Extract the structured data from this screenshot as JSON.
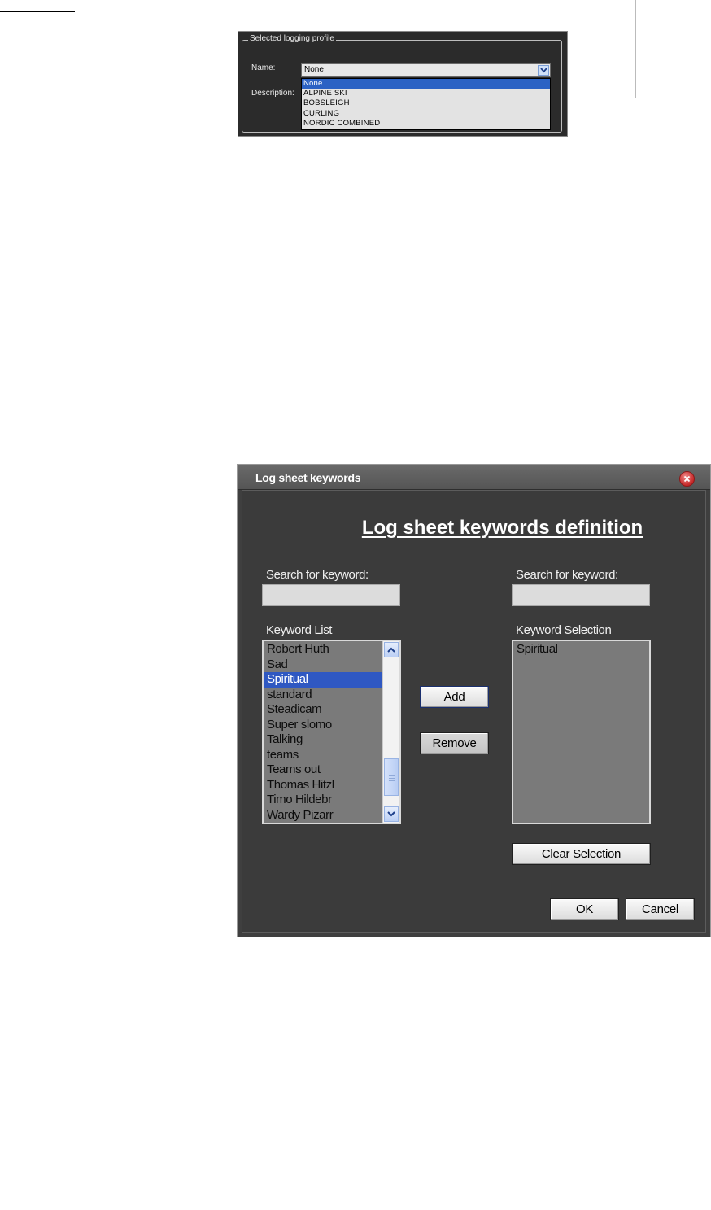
{
  "profile_panel": {
    "group_title": "Selected logging profile",
    "name_label": "Name:",
    "description_label": "Description:",
    "name_value": "None",
    "dropdown_options": [
      "None",
      "ALPINE SKI",
      "BOBSLEIGH",
      "CURLING",
      "NORDIC COMBINED"
    ],
    "selected_option": "None"
  },
  "dialog": {
    "title": "Log sheet keywords",
    "heading": "Log sheet keywords definition",
    "left_search_label": "Search for keyword:",
    "right_search_label": "Search for keyword:",
    "left_search_value": "",
    "right_search_value": "",
    "keyword_list_label": "Keyword List",
    "keyword_selection_label": "Keyword Selection",
    "keyword_list": [
      "Robert Huth",
      "Sad",
      "Spiritual",
      "standard",
      "Steadicam",
      "Super slomo",
      "Talking",
      "teams",
      "Teams out",
      "Thomas Hitzl",
      "Timo Hildebr",
      "Wardy Pizarr"
    ],
    "keyword_list_selected": "Spiritual",
    "keyword_selection": [
      "Spiritual"
    ],
    "add_label": "Add",
    "remove_label": "Remove",
    "clear_label": "Clear Selection",
    "ok_label": "OK",
    "cancel_label": "Cancel"
  },
  "colors": {
    "selection_highlight": "#2f58c2",
    "dialog_background": "#3f3f3f",
    "close_button": "#c62828"
  }
}
